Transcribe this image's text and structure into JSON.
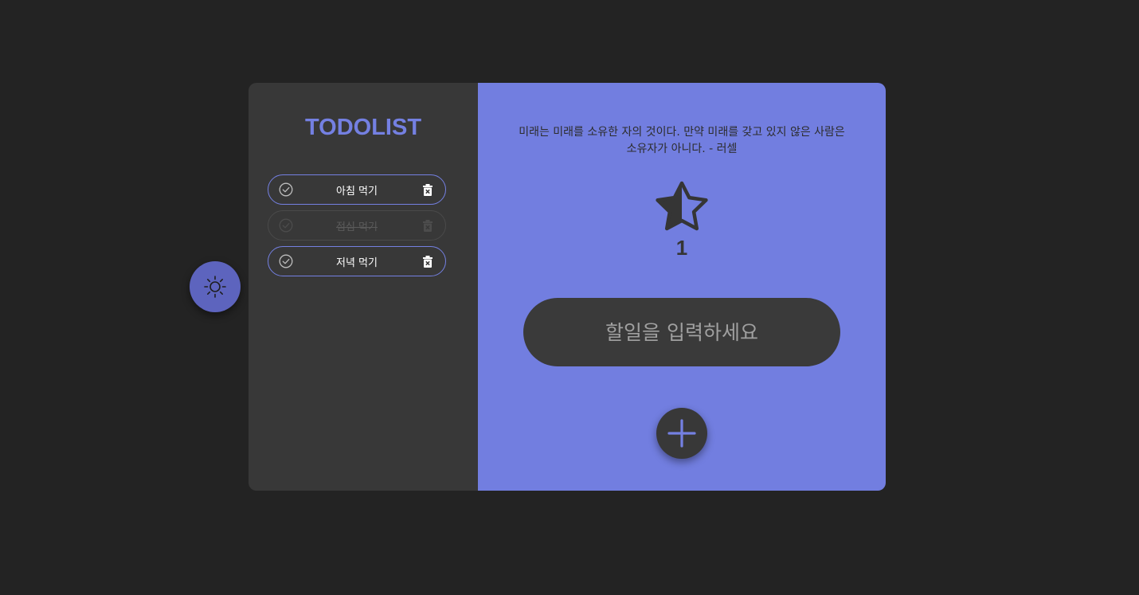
{
  "theme": {
    "toggle_icon": "sun-icon",
    "accent_color": "#7480e2",
    "panel_color": "#383838",
    "background_color": "#232323",
    "toggle_color": "#5d64be"
  },
  "sidebar": {
    "title": "TODOLIST",
    "todos": [
      {
        "text": "아침 먹기",
        "done": false,
        "check_icon": "check-circle-icon",
        "delete_icon": "trash-icon"
      },
      {
        "text": "점심 먹기",
        "done": true,
        "check_icon": "check-circle-icon",
        "delete_icon": "trash-icon"
      },
      {
        "text": "저녁 먹기",
        "done": false,
        "check_icon": "check-circle-icon",
        "delete_icon": "trash-icon"
      }
    ]
  },
  "main": {
    "quote_line1": "미래는 미래를 소유한 자의 것이다. 만약 미래를 갖고 있지 않은 사람은",
    "quote_line2": "소유자가 아니다. - 러셀",
    "star_icon": "half-star-icon",
    "star_count": "1",
    "input_placeholder": "할일을 입력하세요",
    "input_value": "",
    "add_icon": "plus-icon"
  }
}
